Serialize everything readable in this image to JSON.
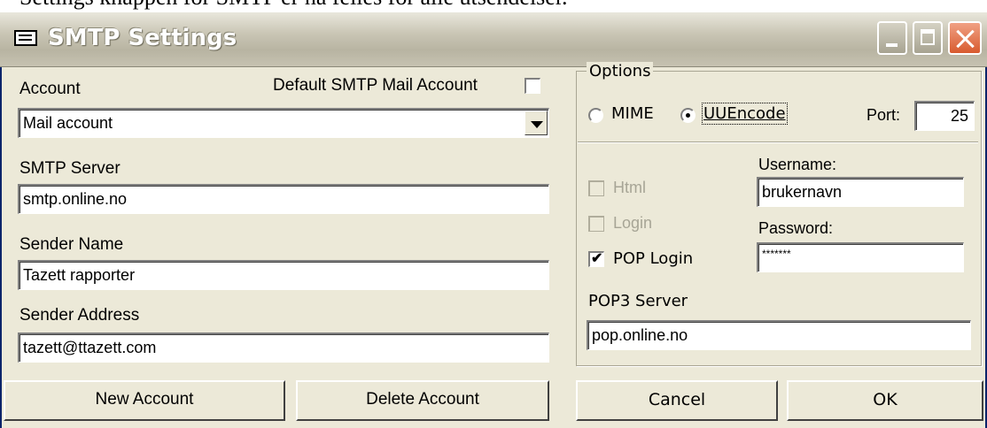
{
  "caption": "Settings knappen for SMTP er nå felles for alle utsendelser.",
  "window": {
    "title": "SMTP Settings"
  },
  "left": {
    "account_label": "Account",
    "default_label": "Default SMTP Mail Account",
    "default_checked": false,
    "account_value": "Mail account",
    "smtp_server_label": "SMTP Server",
    "smtp_server_value": "smtp.online.no",
    "sender_name_label": "Sender Name",
    "sender_name_value": "Tazett rapporter",
    "sender_address_label": "Sender Address",
    "sender_address_value": "tazett@ttazett.com"
  },
  "options": {
    "group_title": "Options",
    "mime_label": "MIME",
    "uuencode_label": "UUEncode",
    "selected_encoding": "UUEncode",
    "port_label": "Port:",
    "port_value": "25",
    "html_label": "Html",
    "html_checked": false,
    "login_label": "Login",
    "login_checked": false,
    "pop_login_label": "POP Login",
    "pop_login_checked": true,
    "username_label": "Username:",
    "username_value": "brukernavn",
    "password_label": "Password:",
    "password_value": "*******",
    "pop3_label": "POP3 Server",
    "pop3_value": "pop.online.no"
  },
  "buttons": {
    "new_account": "New Account",
    "delete_account": "Delete Account",
    "cancel": "Cancel",
    "ok": "OK"
  }
}
